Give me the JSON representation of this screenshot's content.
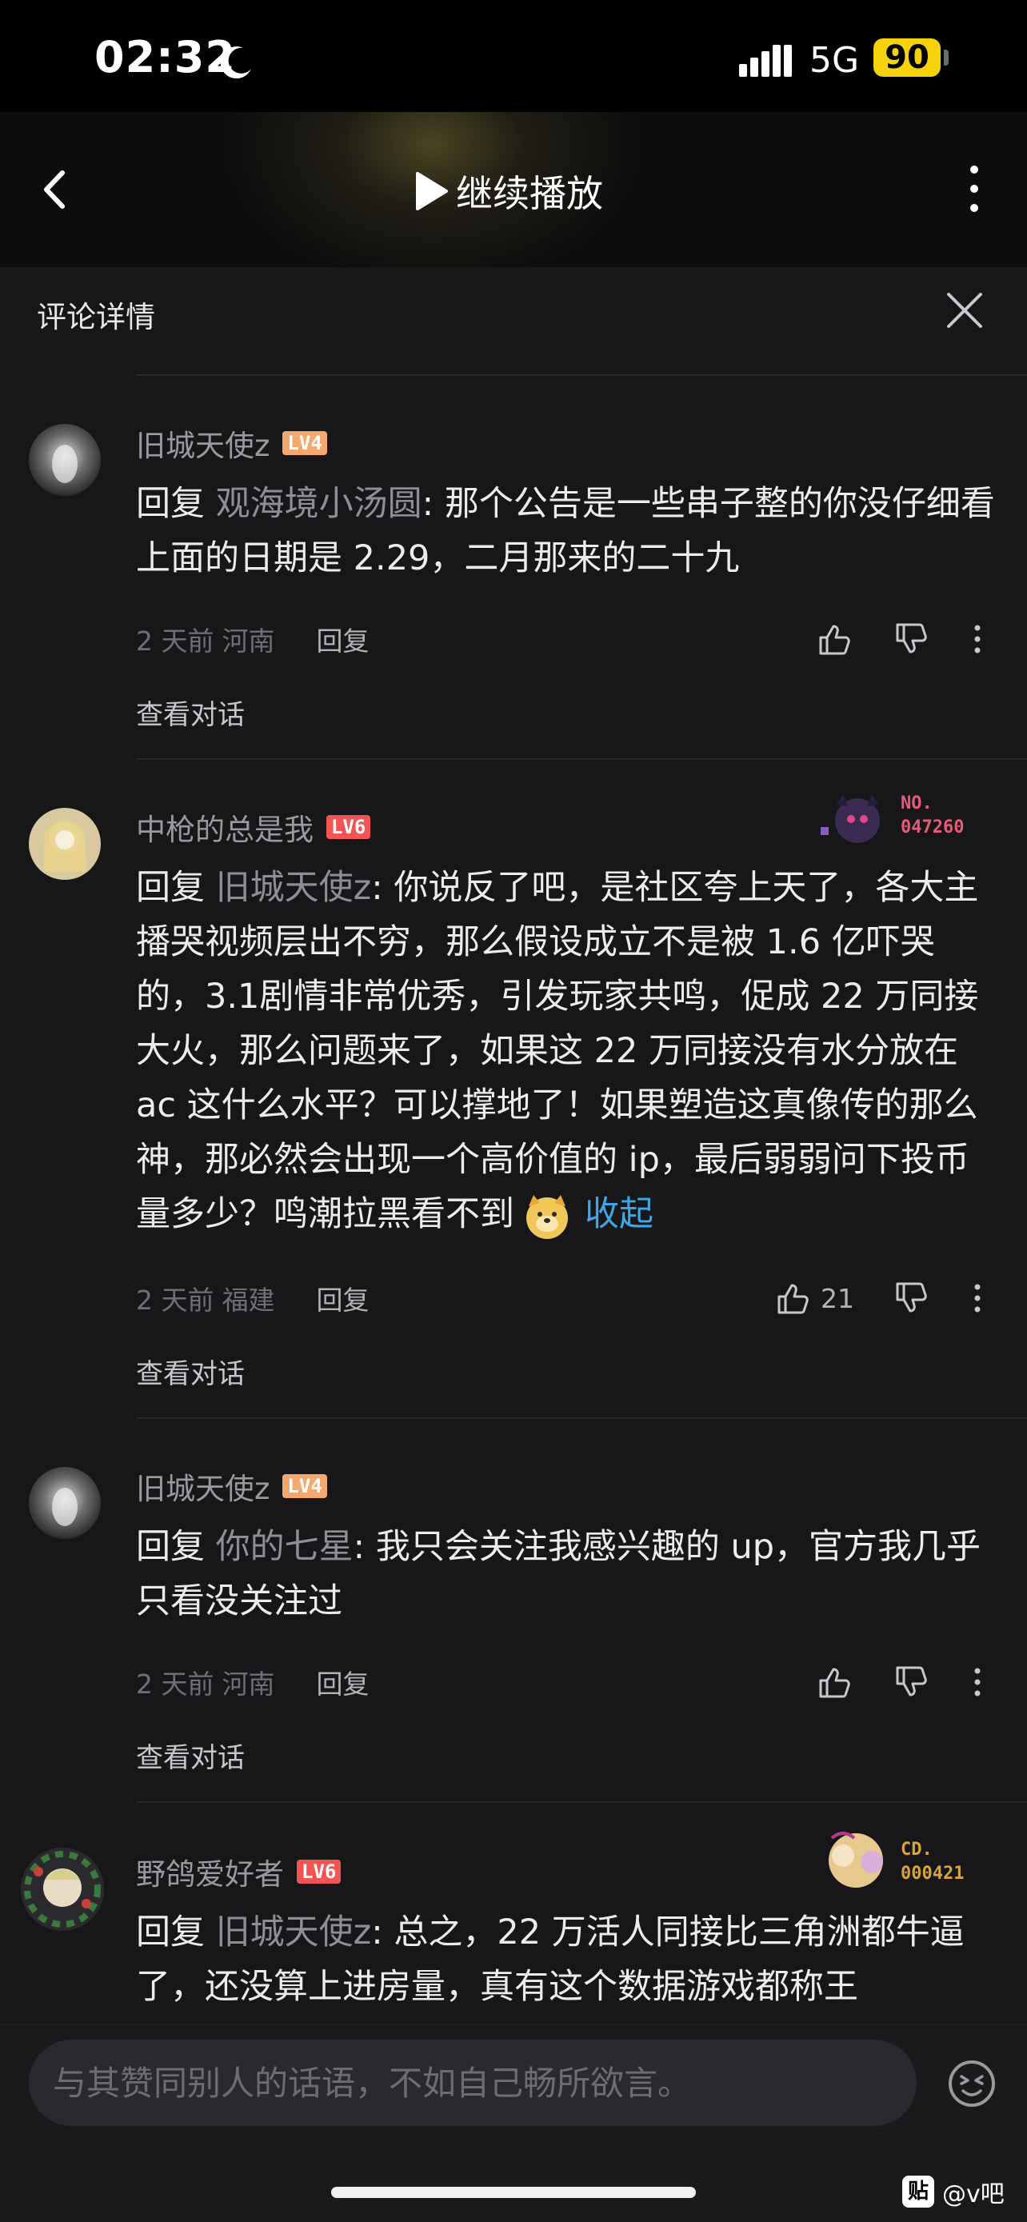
{
  "status_bar": {
    "time": "02:32",
    "network": "5G",
    "battery": "90"
  },
  "header": {
    "resume_label": "继续播放"
  },
  "detail": {
    "title": "评论详情"
  },
  "comments": [
    {
      "username": "旧城天使z",
      "level": "LV4",
      "reply_prefix": "回复 ",
      "reply_target": "观海境小汤圆",
      "text": ": 那个公告是一些串子整的你没仔细看上面的日期是 2.29，二月那来的二十九",
      "time": "2 天前",
      "location": "河南",
      "reply_label": "回复",
      "likes": "",
      "view_conversation": "查看对话"
    },
    {
      "username": "中枪的总是我",
      "level": "LV6",
      "badge": "NO.\n047260",
      "reply_prefix": "回复 ",
      "reply_target": "旧城天使z",
      "text": ": 你说反了吧，是社区夸上天了，各大主播哭视频层出不穷，那么假设成立不是被 1.6 亿吓哭的，3.1剧情非常优秀，引发玩家共鸣，促成 22 万同接大火，那么问题来了，如果这 22 万同接没有水分放在 ac 这什么水平？可以撑地了！如果塑造这真像传的那么神，那必然会出现一个高价值的 ip，最后弱弱问下投币量多少？鸣潮拉黑看不到",
      "collapse_label": "收起",
      "time": "2 天前",
      "location": "福建",
      "reply_label": "回复",
      "likes": "21",
      "view_conversation": "查看对话"
    },
    {
      "username": "旧城天使z",
      "level": "LV4",
      "reply_prefix": "回复 ",
      "reply_target": "你的七星",
      "text": ": 我只会关注我感兴趣的 up，官方我几乎只看没关注过",
      "time": "2 天前",
      "location": "河南",
      "reply_label": "回复",
      "likes": "",
      "view_conversation": "查看对话"
    },
    {
      "username": "野鸽爱好者",
      "level": "LV6",
      "badge": "CD.\n000421",
      "reply_prefix": "回复 ",
      "reply_target": "旧城天使z",
      "text": ": 总之，22 万活人同接比三角洲都牛逼了，还没算上进房量，真有这个数据游戏都称王"
    }
  ],
  "input": {
    "placeholder": "与其赞同别人的话语，不如自己畅所欲言。"
  },
  "watermark": {
    "logo": "贴",
    "text": "@v吧"
  },
  "icons": {
    "back": "chevron-left-icon",
    "play": "play-icon",
    "more": "more-vertical-icon",
    "close": "close-icon",
    "like": "thumb-up-icon",
    "dislike": "thumb-down-icon",
    "emoji": "emoji-icon",
    "moon": "moon-icon",
    "signal": "signal-icon"
  },
  "colors": {
    "background": "#17171a",
    "link": "#3fa7e8",
    "lv4": "#f2a86e",
    "lv6": "#f35555",
    "battery": "#f5d20a"
  }
}
